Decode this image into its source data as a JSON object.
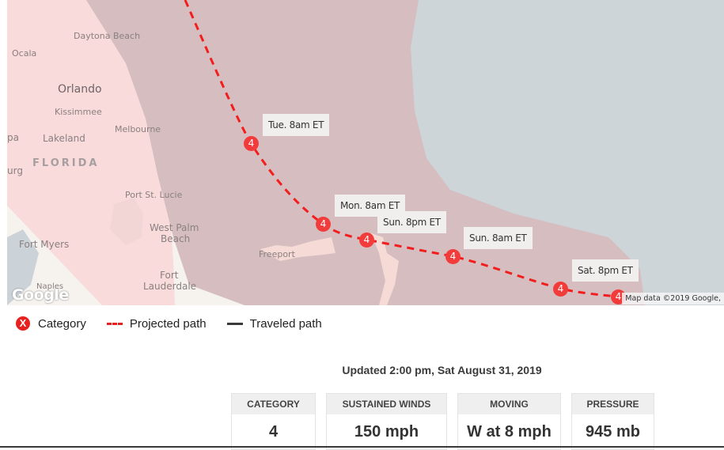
{
  "map": {
    "cities": [
      {
        "name": "Daytona Beach",
        "cls": ""
      },
      {
        "name": "Ocala",
        "cls": ""
      },
      {
        "name": "Orlando",
        "cls": "big"
      },
      {
        "name": "Kissimmee",
        "cls": ""
      },
      {
        "name": "Melbourne",
        "cls": ""
      },
      {
        "name": "Lakeland",
        "cls": ""
      },
      {
        "name": "pa",
        "cls": ""
      },
      {
        "name": "FLORIDA",
        "cls": "state"
      },
      {
        "name": "urg",
        "cls": ""
      },
      {
        "name": "Port St. Lucie",
        "cls": ""
      },
      {
        "name": "West Palm",
        "cls": ""
      },
      {
        "name": "Beach",
        "cls": ""
      },
      {
        "name": "Fort Myers",
        "cls": ""
      },
      {
        "name": "Fort",
        "cls": ""
      },
      {
        "name": "Lauderdale",
        "cls": ""
      },
      {
        "name": "Naples",
        "cls": ""
      },
      {
        "name": "Freeport",
        "cls": ""
      }
    ],
    "forecast_points": [
      {
        "time": "Tue. 8am ET",
        "category": "4"
      },
      {
        "time": "Mon. 8am ET",
        "category": "4"
      },
      {
        "time": "Sun. 8pm ET",
        "category": "4"
      },
      {
        "time": "Sun. 8am ET",
        "category": "4"
      },
      {
        "time": "Sat. 8pm ET",
        "category": "4"
      },
      {
        "time": "",
        "category": "4"
      }
    ],
    "google_logo": "Google",
    "attribution": "Map data ©2019 Google,",
    "colors": {
      "path": "#f21d1d",
      "marker": "#f23c3c",
      "cone": "#d6bec0",
      "water": "#cdd5d9"
    }
  },
  "legend": {
    "category_icon": "X",
    "category_label": "Category",
    "projected_label": "Projected path",
    "traveled_label": "Traveled path"
  },
  "updated": "Updated 2:00 pm, Sat August 31, 2019",
  "stats": [
    {
      "label": "CATEGORY",
      "value": "4"
    },
    {
      "label": "SUSTAINED WINDS",
      "value": "150 mph"
    },
    {
      "label": "MOVING",
      "value": "W at 8 mph"
    },
    {
      "label": "PRESSURE",
      "value": "945 mb"
    }
  ]
}
